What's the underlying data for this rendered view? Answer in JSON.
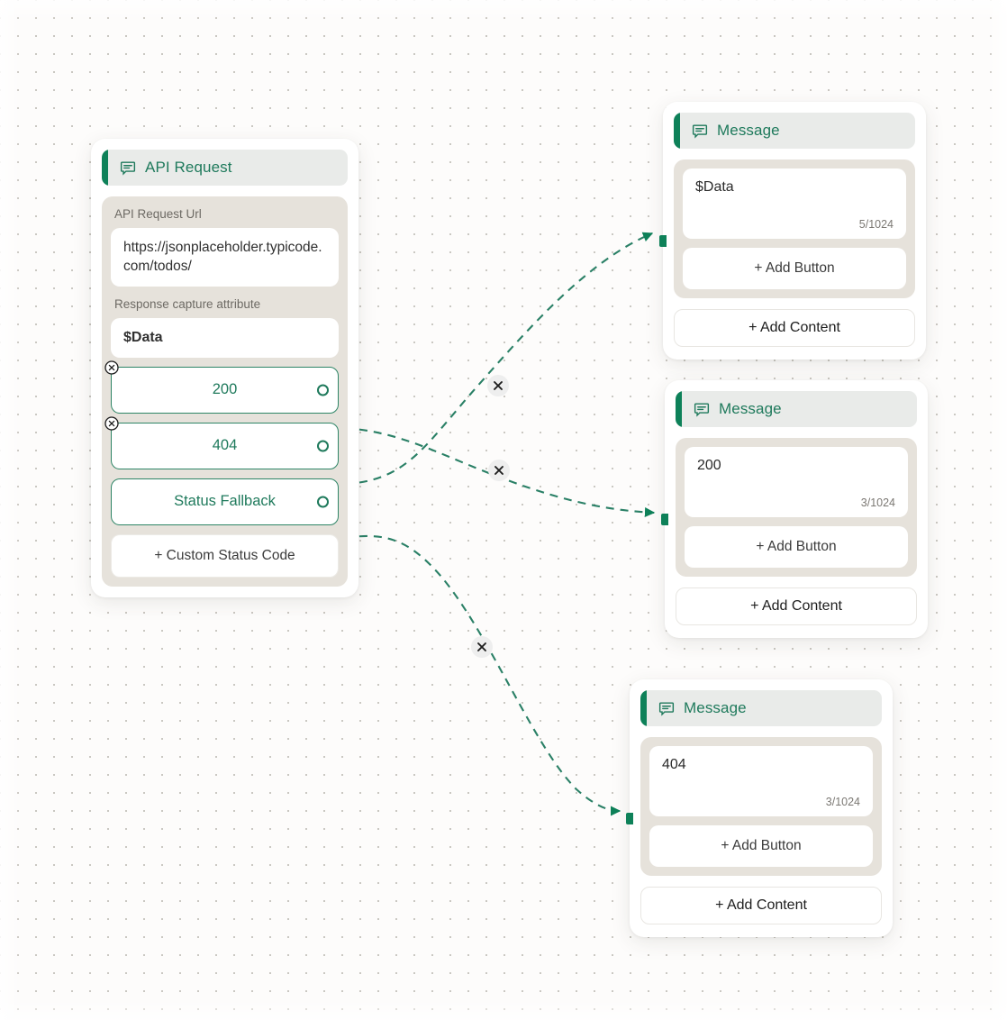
{
  "canvas": {
    "accent_green": "#0e8159",
    "edge_color": "#2a8066",
    "panel_beige": "#e6e2db",
    "header_bg": "#e9ebe9",
    "background": "#fdfcfb"
  },
  "nodes": {
    "api_request": {
      "title": "API Request",
      "icon": "message-bubble-icon",
      "url_label": "API Request Url",
      "url_value": "https://jsonplaceholder.typicode.com/todos/",
      "capture_label": "Response capture attribute",
      "capture_value": "$Data",
      "status_codes": [
        {
          "label": "200",
          "removable": true
        },
        {
          "label": "404",
          "removable": true
        },
        {
          "label": "Status Fallback",
          "removable": false
        }
      ],
      "add_status_label": "+ Custom Status Code"
    },
    "messages": [
      {
        "title": "Message",
        "icon": "message-bubble-icon",
        "text": "$Data",
        "counter": "5/1024",
        "add_button_label": "+ Add Button",
        "add_content_label": "+ Add Content"
      },
      {
        "title": "Message",
        "icon": "message-bubble-icon",
        "text": "200",
        "counter": "3/1024",
        "add_button_label": "+ Add Button",
        "add_content_label": "+ Add Content"
      },
      {
        "title": "Message",
        "icon": "message-bubble-icon",
        "text": "404",
        "counter": "3/1024",
        "add_button_label": "+ Add Button",
        "add_content_label": "+ Add Content"
      }
    ]
  },
  "edges": [
    {
      "from": "404",
      "to": "message-1",
      "delete_label": "×"
    },
    {
      "from": "200",
      "to": "message-2",
      "delete_label": "×"
    },
    {
      "from": "Status Fallback",
      "to": "message-3",
      "delete_label": "×"
    }
  ]
}
